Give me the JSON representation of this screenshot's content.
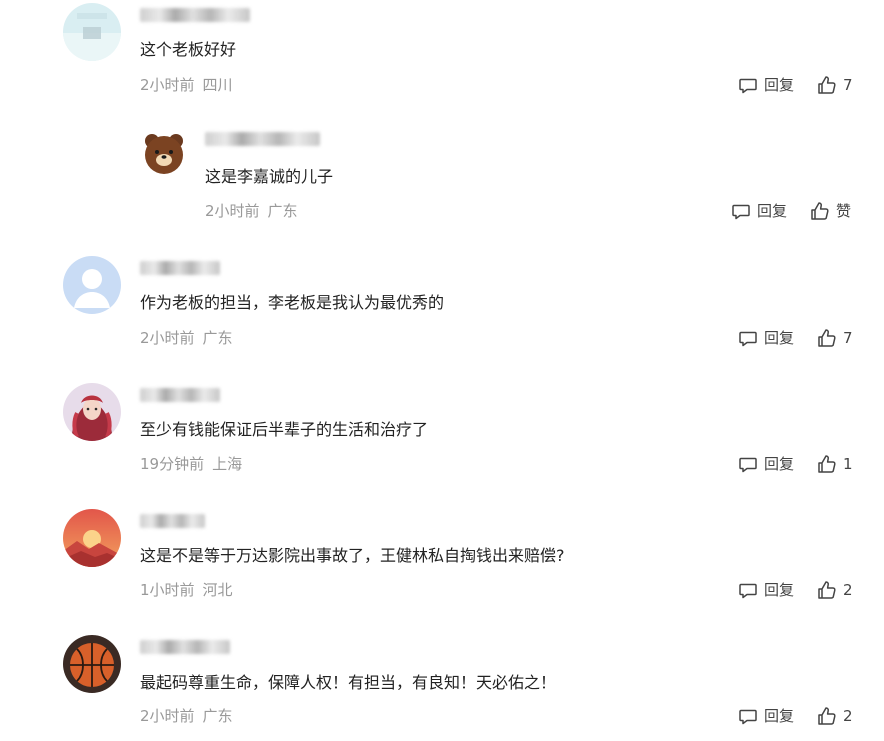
{
  "comments": [
    {
      "text": "这个老板好好",
      "time": "2小时前",
      "location": "四川",
      "reply_label": "回复",
      "like_count": "7",
      "avatar_icon": "blurred-user-avatar"
    },
    {
      "text": "这是李嘉诚的儿子",
      "time": "2小时前",
      "location": "广东",
      "reply_label": "回复",
      "like_count": "赞",
      "avatar_icon": "brown-bear-avatar"
    },
    {
      "text": "作为老板的担当，李老板是我认为最优秀的",
      "time": "2小时前",
      "location": "广东",
      "reply_label": "回复",
      "like_count": "7",
      "avatar_icon": "default-user-avatar"
    },
    {
      "text": "至少有钱能保证后半辈子的生活和治疗了",
      "time": "19分钟前",
      "location": "上海",
      "reply_label": "回复",
      "like_count": "1",
      "avatar_icon": "anime-character-avatar"
    },
    {
      "text": "这是不是等于万达影院出事故了，王健林私自掏钱出来赔偿?",
      "time": "1小时前",
      "location": "河北",
      "reply_label": "回复",
      "like_count": "2",
      "avatar_icon": "sunset-landscape-avatar"
    },
    {
      "text": "最起码尊重生命，保障人权！有担当，有良知！天必佑之！",
      "time": "2小时前",
      "location": "广东",
      "reply_label": "回复",
      "like_count": "2",
      "avatar_icon": "basketball-avatar"
    }
  ],
  "colors": {
    "text": "#222222",
    "meta": "#999999",
    "action": "#444444"
  }
}
